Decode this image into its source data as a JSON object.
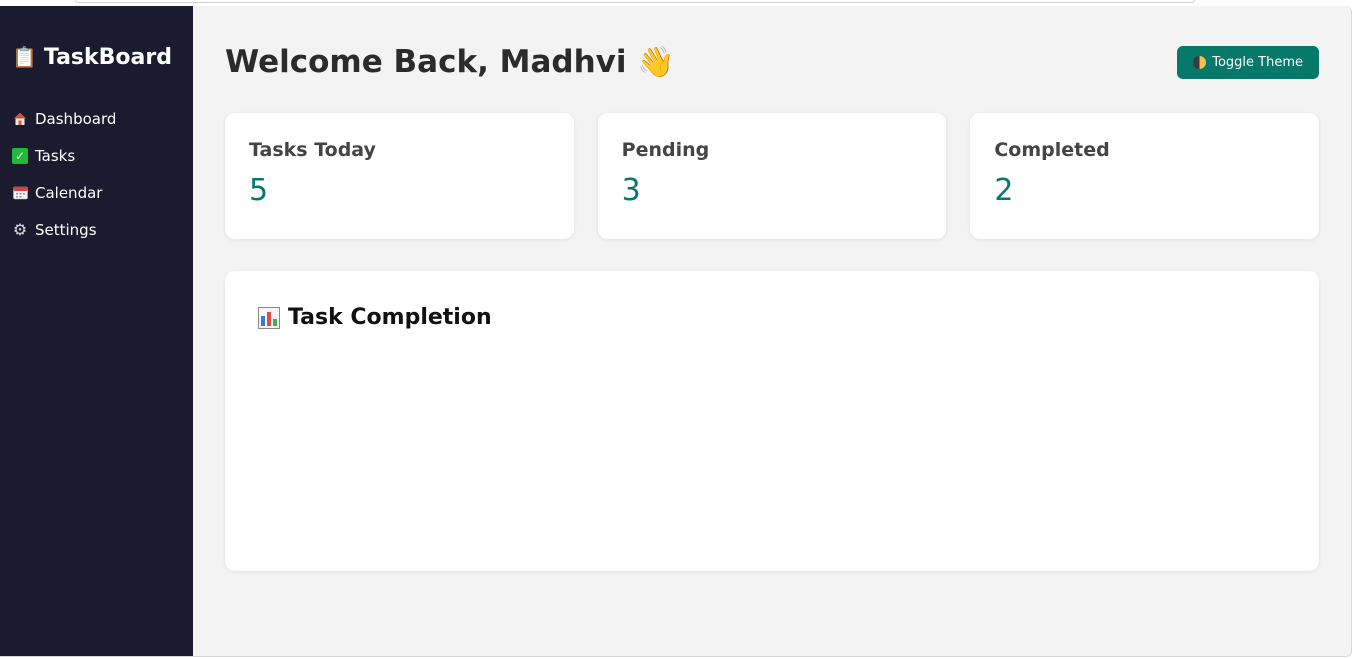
{
  "sidebar": {
    "brand": "TaskBoard",
    "brand_icon": "clipboard-icon",
    "items": [
      {
        "label": "Dashboard",
        "icon": "house-icon"
      },
      {
        "label": "Tasks",
        "icon": "check-icon"
      },
      {
        "label": "Calendar",
        "icon": "calendar-icon"
      },
      {
        "label": "Settings",
        "icon": "gear-icon"
      }
    ]
  },
  "header": {
    "title": "Welcome Back, Madhvi",
    "wave": "👋",
    "toggle_label": "Toggle Theme"
  },
  "stats": [
    {
      "label": "Tasks Today",
      "value": "5"
    },
    {
      "label": "Pending",
      "value": "3"
    },
    {
      "label": "Completed",
      "value": "2"
    }
  ],
  "chart": {
    "title": "Task Completion",
    "icon": "bar-chart-icon"
  },
  "colors": {
    "accent": "#08786a",
    "sidebar_bg": "#1b1b2f",
    "page_bg": "#f3f3f3"
  }
}
